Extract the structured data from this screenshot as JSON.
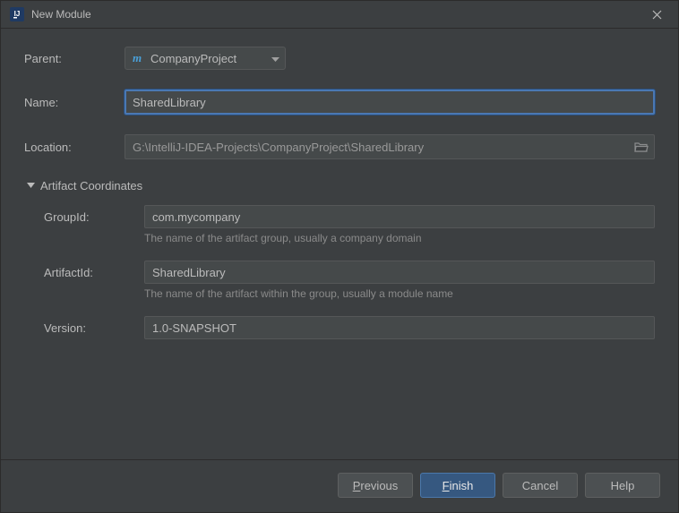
{
  "window": {
    "title": "New Module"
  },
  "form": {
    "parent_label": "Parent:",
    "parent_value": "CompanyProject",
    "name_label": "Name:",
    "name_value": "SharedLibrary",
    "location_label": "Location:",
    "location_value": "G:\\IntelliJ-IDEA-Projects\\CompanyProject\\SharedLibrary",
    "artifact_section_label": "Artifact Coordinates",
    "groupid_label": "GroupId:",
    "groupid_value": "com.mycompany",
    "groupid_hint": "The name of the artifact group, usually a company domain",
    "artifactid_label": "ArtifactId:",
    "artifactid_value": "SharedLibrary",
    "artifactid_hint": "The name of the artifact within the group, usually a module name",
    "version_label": "Version:",
    "version_value": "1.0-SNAPSHOT"
  },
  "buttons": {
    "previous": "revious",
    "previous_m": "P",
    "finish": "inish",
    "finish_m": "F",
    "cancel": "Cancel",
    "help": "Help"
  },
  "icons": {
    "maven": "maven-icon",
    "folder": "folder-open-icon",
    "close": "close-icon",
    "triangle": "triangle-down-icon"
  }
}
